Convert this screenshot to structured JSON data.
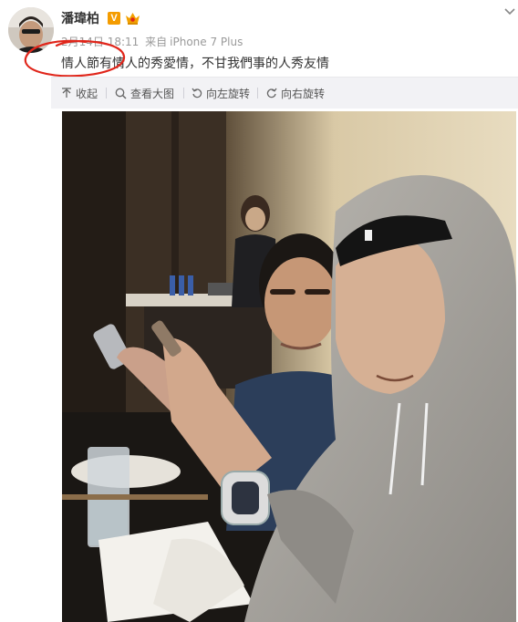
{
  "post": {
    "author": "潘瑋柏",
    "verified_badge": "V",
    "vip_icon": "vip-crown-icon",
    "timestamp": "2月14日 18:11",
    "source_prefix": "来自",
    "source_device": "iPhone 7 Plus",
    "text": "情人節有情人的秀愛情，不甘我們事的人秀友情",
    "annotation_color": "#e0261b"
  },
  "toolbar": {
    "collapse_label": "收起",
    "view_large_label": "查看大图",
    "rotate_left_label": "向左旋转",
    "rotate_right_label": "向右旋转"
  },
  "colors": {
    "badge_orange": "#f49c00",
    "meta_gray": "#9a9a9a",
    "toolbar_bg": "#f2f2f5"
  }
}
